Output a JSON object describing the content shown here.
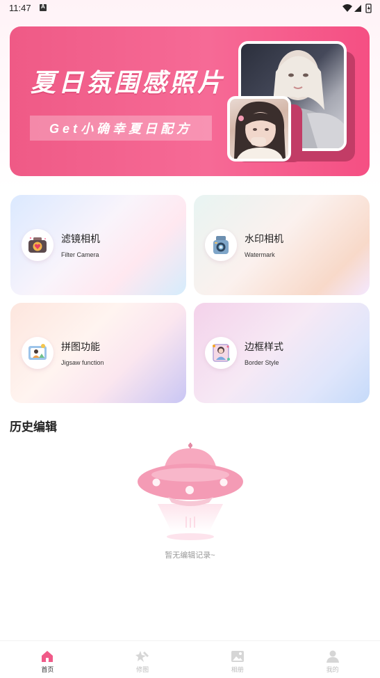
{
  "status_bar": {
    "time": "11:47"
  },
  "banner": {
    "title": "夏日氛围感照片",
    "subtitle": "Get小确幸夏日配方"
  },
  "features": [
    {
      "title": "滤镜相机",
      "subtitle": "Filter Camera",
      "icon": "camera-heart-icon"
    },
    {
      "title": "水印相机",
      "subtitle": "Watermark",
      "icon": "vintage-camera-icon"
    },
    {
      "title": "拼图功能",
      "subtitle": "Jigsaw function",
      "icon": "photo-collage-icon"
    },
    {
      "title": "边框样式",
      "subtitle": "Border Style",
      "icon": "framed-portrait-icon"
    }
  ],
  "history": {
    "title": "历史编辑",
    "empty_text": "暂无编辑记录~"
  },
  "bottom_nav": [
    {
      "label": "首页",
      "icon": "home-icon",
      "active": true
    },
    {
      "label": "修图",
      "icon": "edit-star-icon",
      "active": false
    },
    {
      "label": "相册",
      "icon": "gallery-icon",
      "active": false
    },
    {
      "label": "我的",
      "icon": "profile-icon",
      "active": false
    }
  ],
  "colors": {
    "accent": "#f05a88",
    "nav_active": "#f05a88",
    "nav_inactive": "#d6d6d6"
  }
}
